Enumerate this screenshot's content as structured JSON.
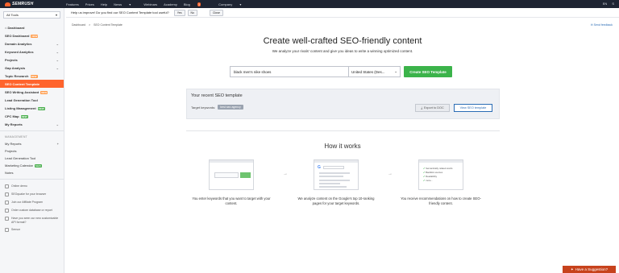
{
  "topbar": {
    "logo": "SEMRUSH",
    "nav": [
      {
        "label": "Features"
      },
      {
        "label": "Prices"
      },
      {
        "label": "Help"
      },
      {
        "label": "News"
      },
      {
        "label": "Webinars"
      },
      {
        "label": "Academy"
      },
      {
        "label": "Blog",
        "badge": "3"
      },
      {
        "label": "Company"
      }
    ],
    "lang": "EN",
    "user": "S"
  },
  "sidebar": {
    "tool_select": "All Tools",
    "items": [
      {
        "label": "Dashboard"
      },
      {
        "label": "SEO Dashboard",
        "badge": "NEW"
      },
      {
        "label": "Domain Analytics"
      },
      {
        "label": "Keyword Analytics"
      },
      {
        "label": "Projects"
      },
      {
        "label": "Gap Analysis"
      },
      {
        "label": "Topic Research",
        "badge": "NEW"
      },
      {
        "label": "SEO Content Template"
      },
      {
        "label": "SEO Writing Assistant",
        "badge": "NEW"
      },
      {
        "label": "Lead Generation Tool"
      },
      {
        "label": "Listing Management",
        "badge": "NEW"
      },
      {
        "label": "CPC Map",
        "badge": "NEW"
      },
      {
        "label": "My Reports"
      }
    ],
    "management_heading": "MANAGEMENT",
    "management": [
      {
        "label": "My Reports"
      },
      {
        "label": "Projects"
      },
      {
        "label": "Lead Generation Tool"
      },
      {
        "label": "Marketing Calendar",
        "badge": "NEW"
      },
      {
        "label": "Notes"
      }
    ],
    "footer": [
      {
        "label": "Online demo"
      },
      {
        "label": "SEOquake for your browser"
      },
      {
        "label": "Join our Affiliate Program"
      },
      {
        "label": "Order custom database or report"
      },
      {
        "label": "Have you seen our new customizable API format?"
      },
      {
        "label": "Sensor"
      }
    ]
  },
  "notice": {
    "text": "Help us improve! Do you find our SEO Content Template tool useful?",
    "yes": "Yes",
    "no": "No",
    "close": "Close"
  },
  "main": {
    "breadcrumb_home": "Dashboard",
    "breadcrumb_sep": ">",
    "breadcrumb_current": "SEO Content Template",
    "feedback": "Send feedback",
    "title": "Create well-crafted SEO-friendly content",
    "subtitle": "We analyze your rivals' content and give you ideas to write a winning optimized content.",
    "keyword_value": "black men's nike shoes",
    "database_value": "United States (Des...",
    "create_button": "Create SEO Template",
    "recent": {
      "title": "Your recent SEO template",
      "keywords_label": "Target keywords:",
      "keyword_chip": "best seo agency",
      "export_button": "Export to DOC",
      "view_button": "View SEO template"
    },
    "how_title": "How it works",
    "steps": [
      {
        "text": "You enter keywords that you want to target with your content."
      },
      {
        "text": "We analyze content on the Google's top 10-ranking pages for your target keywords."
      },
      {
        "text": "You receive recommendations on how to create SEO-friendly content."
      }
    ],
    "step3_checks": [
      "Semantically related words",
      "Backlink sources",
      "Readability",
      "more..."
    ]
  },
  "suggest_button": "Have a Suggestion?",
  "colors": {
    "brand_orange": "#ff642d",
    "green": "#3bb34a",
    "link_blue": "#2b6cb5",
    "topbar": "#1f2533"
  }
}
